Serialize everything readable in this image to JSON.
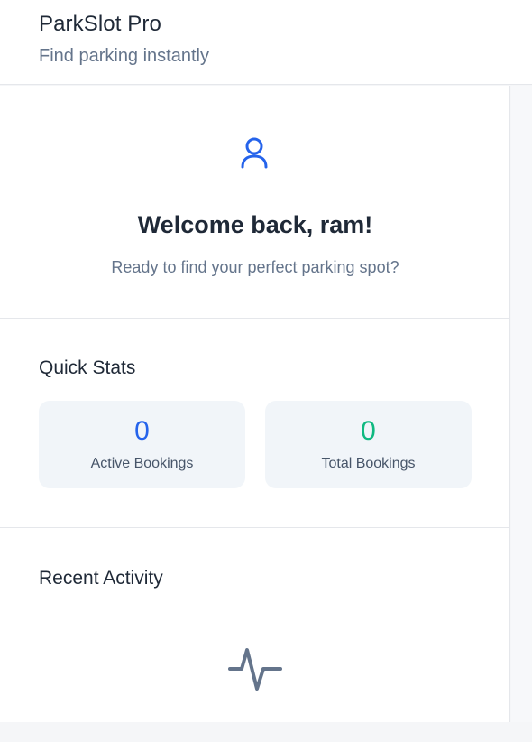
{
  "header": {
    "title": "ParkSlot Pro",
    "subtitle": "Find parking instantly"
  },
  "welcome": {
    "icon": "user-icon",
    "title": "Welcome back, ram!",
    "subtitle": "Ready to find your perfect parking spot?"
  },
  "stats": {
    "title": "Quick Stats",
    "cards": [
      {
        "value": "0",
        "label": "Active Bookings",
        "color": "#2563eb"
      },
      {
        "value": "0",
        "label": "Total Bookings",
        "color": "#10b981"
      }
    ]
  },
  "activity": {
    "title": "Recent Activity",
    "icon": "activity-pulse-icon"
  },
  "colors": {
    "accent_blue": "#2563eb",
    "accent_green": "#10b981",
    "muted_text": "#64748b",
    "card_bg": "#f1f5f9"
  }
}
